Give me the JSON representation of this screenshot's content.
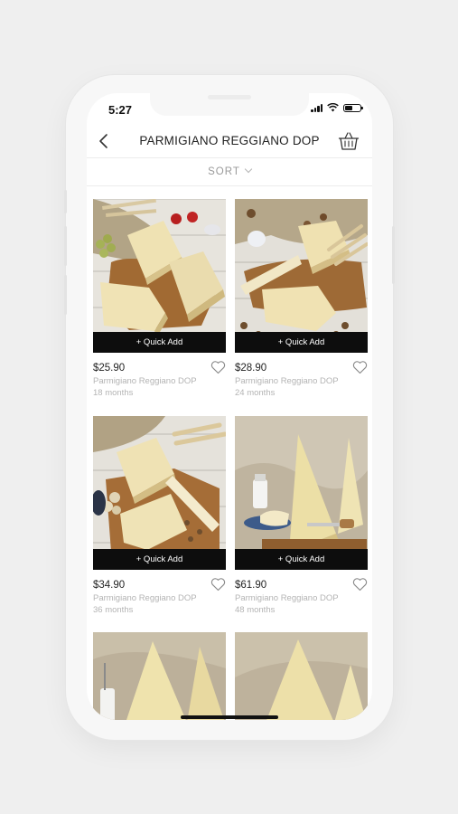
{
  "status": {
    "time": "5:27"
  },
  "header": {
    "title": "PARMIGIANO REGGIANO DOP"
  },
  "sort": {
    "label": "SORT"
  },
  "products": [
    {
      "price": "$25.90",
      "name": "Parmigiano Reggiano DOP",
      "age": "18 months",
      "quick_add": "+ Quick Add"
    },
    {
      "price": "$28.90",
      "name": "Parmigiano Reggiano DOP",
      "age": "24 months",
      "quick_add": "+ Quick Add"
    },
    {
      "price": "$34.90",
      "name": "Parmigiano Reggiano DOP",
      "age": "36 months",
      "quick_add": "+ Quick Add"
    },
    {
      "price": "$61.90",
      "name": "Parmigiano Reggiano DOP",
      "age": "48 months",
      "quick_add": "+ Quick Add"
    }
  ],
  "colors": {
    "quick_add_bg": "#0d0d0d",
    "price": "#222222",
    "subtext": "#b4b4b4",
    "background": "#efefef"
  },
  "icons": [
    "back-chevron-icon",
    "cart-basket-icon",
    "heart-outline-icon",
    "signal-icon",
    "wifi-icon",
    "battery-icon"
  ]
}
